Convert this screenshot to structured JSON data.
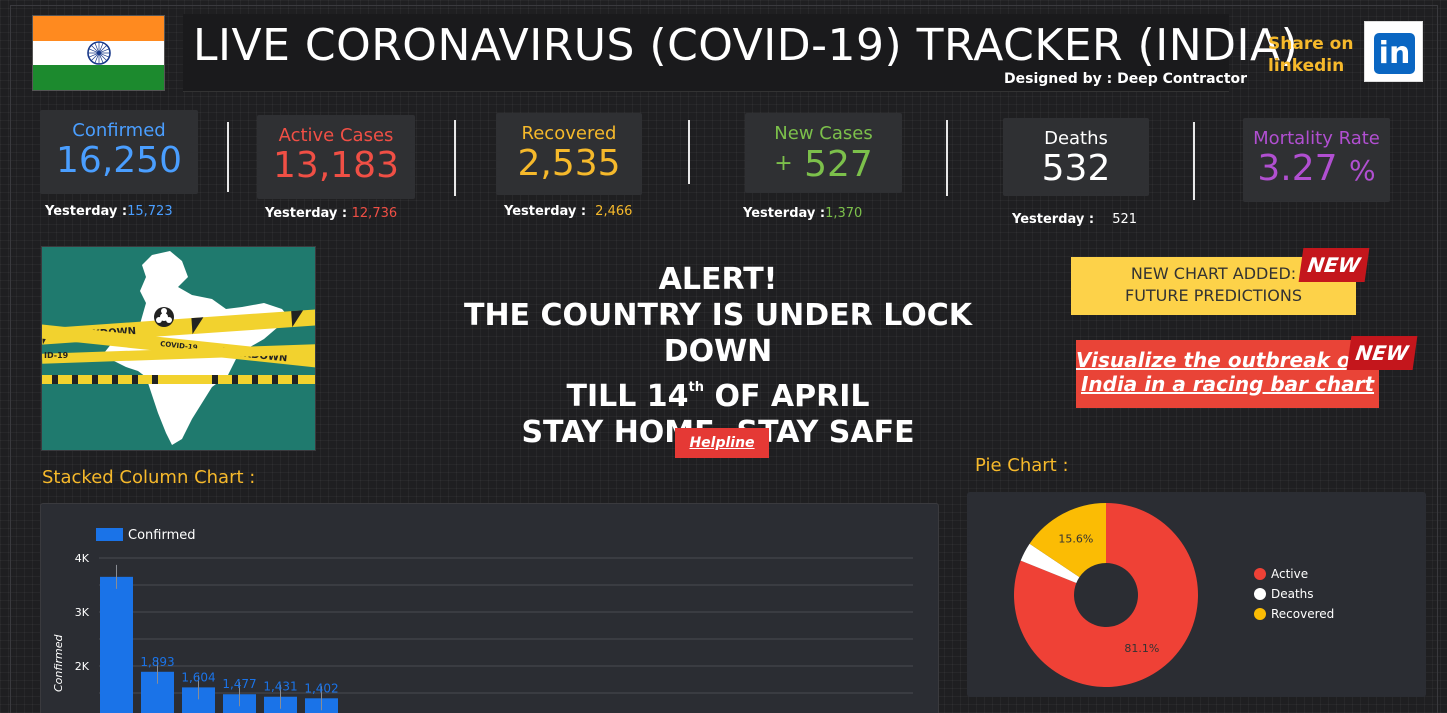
{
  "header": {
    "title": "LIVE CORONAVIRUS (COVID-19) TRACKER (INDIA)",
    "designer": "Designed by : Deep Contractor",
    "share_label": "Share on linkedin",
    "linkedin_icon_text": "in"
  },
  "stats": [
    {
      "label": "Confirmed",
      "value": "16,250",
      "yesterday_label": "Yesterday :",
      "yesterday_value": "15,723",
      "color": "#4a9eff"
    },
    {
      "label": "Active Cases",
      "value": "13,183",
      "yesterday_label": "Yesterday :",
      "yesterday_value": "12,736",
      "color": "#f04f45"
    },
    {
      "label": "Recovered",
      "value": "2,535",
      "yesterday_label": "Yesterday :",
      "yesterday_value": "2,466",
      "color": "#f6b92b"
    },
    {
      "label": "New Cases",
      "value_prefix": "+",
      "value": "527",
      "yesterday_label": "Yesterday :",
      "yesterday_value": "1,370",
      "color": "#7cc04b"
    },
    {
      "label": "Deaths",
      "value": "532",
      "yesterday_label": "Yesterday :",
      "yesterday_value": "521",
      "color": "#ffffff"
    },
    {
      "label": "Mortality Rate",
      "value": "3.27",
      "value_suffix": "%",
      "color": "#b14fd1"
    }
  ],
  "alert": {
    "line1": "ALERT!",
    "line2": "THE COUNTRY IS UNDER LOCK DOWN",
    "line3_pre": "TILL 14",
    "line3_sup": "th",
    "line3_post": " OF APRIL",
    "line4": "STAY HOME, STAY SAFE",
    "helpline": "Helpline"
  },
  "map_image": {
    "tape_text_1": "LOCKDOWN",
    "tape_text_2": "COVID-19",
    "tape_text_3": "LOCKDOWN",
    "tape_text_4": "ID-19"
  },
  "promos": {
    "new_chart_line1": "NEW CHART ADDED:",
    "new_chart_line2": "FUTURE PREDICTIONS",
    "racing_line1": "Visualize the outbreak outside",
    "racing_line2": "India in a racing bar chart",
    "new_badge": "NEW"
  },
  "sections": {
    "stacked": "Stacked Column Chart :",
    "pie": "Pie Chart :"
  },
  "colors": {
    "bar": "#1a73e8",
    "active": "#ef4136",
    "deaths": "#ffffff",
    "recovered": "#fbbc04"
  },
  "chart_data": [
    {
      "type": "bar",
      "legend": [
        "Confirmed"
      ],
      "ylabel": "Confirmed",
      "ylim": [
        0,
        4000
      ],
      "yticks": [
        "4K",
        "3K",
        "2K"
      ],
      "tick_values": [
        4000,
        3000,
        2000
      ],
      "series": [
        {
          "name": "Confirmed",
          "values": [
            3651,
            1893,
            1604,
            1477,
            1431,
            1402
          ]
        }
      ],
      "data_labels": [
        "",
        "1,893",
        "1,604",
        "1,477",
        "1,431",
        "1,402"
      ],
      "grid": true,
      "legend_position": "top-left"
    },
    {
      "type": "pie",
      "slices": [
        {
          "name": "Active",
          "value": 81.1,
          "label": "81.1%"
        },
        {
          "name": "Deaths",
          "value": 3.3,
          "label": ""
        },
        {
          "name": "Recovered",
          "value": 15.6,
          "label": "15.6%"
        }
      ],
      "legend_position": "right"
    }
  ]
}
